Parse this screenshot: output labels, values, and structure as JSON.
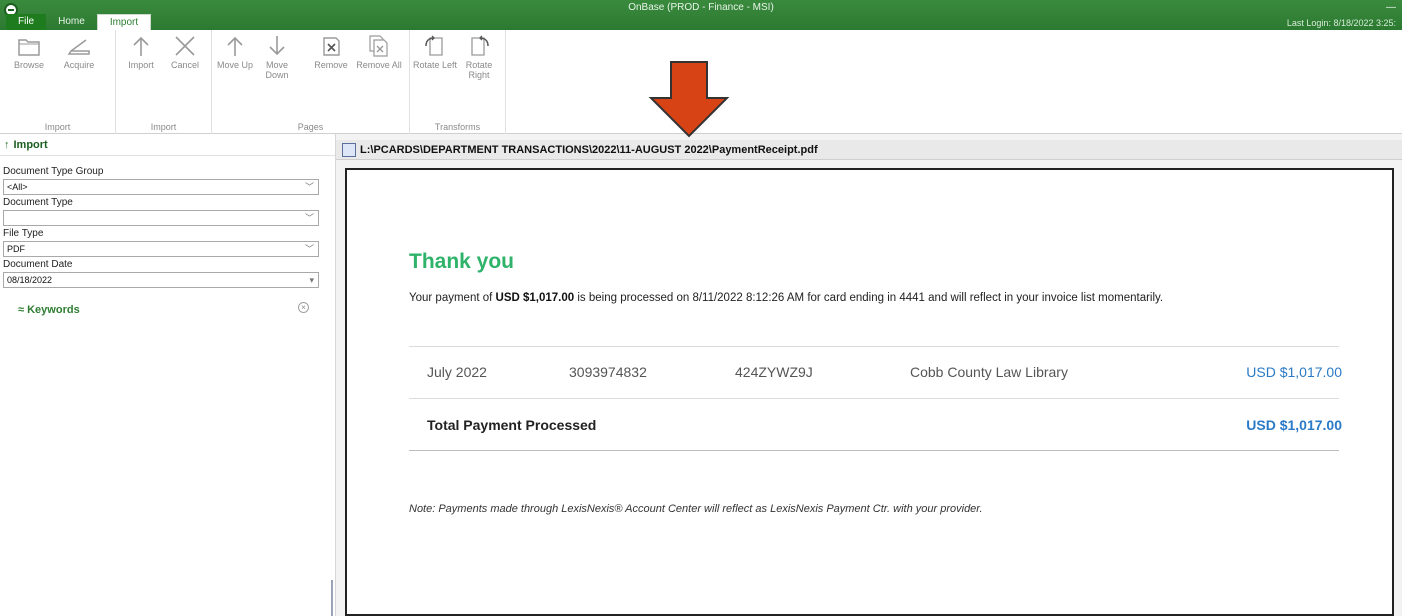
{
  "window": {
    "title": "OnBase (PROD - Finance - MSI)",
    "last_login": "Last Login: 8/18/2022 3:25:",
    "minimize": "—"
  },
  "tabs": [
    {
      "label": "File"
    },
    {
      "label": "Home"
    },
    {
      "label": "Import"
    }
  ],
  "ribbon": {
    "groups": [
      {
        "label": "Import"
      },
      {
        "label": "Import"
      },
      {
        "label": "Pages"
      },
      {
        "label": "Transforms"
      }
    ],
    "buttons": {
      "browse": "Browse",
      "acquire": "Acquire",
      "import": "Import",
      "cancel": "Cancel",
      "move_up": "Move Up",
      "move_down": "Move Down",
      "remove": "Remove",
      "remove_all": "Remove All",
      "rotate_left": "Rotate Left",
      "rotate_right": "Rotate Right"
    }
  },
  "left_panel": {
    "header": "Import",
    "fields": {
      "doc_type_group_label": "Document Type Group",
      "doc_type_group_value": "<All>",
      "doc_type_label": "Document Type",
      "doc_type_value": "",
      "file_type_label": "File Type",
      "file_type_value": "PDF",
      "doc_date_label": "Document Date",
      "doc_date_value": "08/18/2022"
    },
    "keywords_label": "Keywords"
  },
  "path": "L:\\PCARDS\\DEPARTMENT TRANSACTIONS\\2022\\11-AUGUST 2022\\PaymentReceipt.pdf",
  "document": {
    "title": "Thank you",
    "msg_prefix": "Your payment of ",
    "msg_amount": "USD $1,017.00",
    "msg_suffix": " is being processed on 8/11/2022 8:12:26 AM for card ending in 4441 and will reflect in your invoice list momentarily.",
    "row": {
      "period": "July 2022",
      "number": "3093974832",
      "code": "424ZYWZ9J",
      "vendor": "Cobb County Law Library",
      "amount": "USD $1,017.00"
    },
    "total_label": "Total Payment Processed",
    "total_amount": "USD $1,017.00",
    "note": "Note: Payments made through LexisNexis® Account Center will reflect as LexisNexis Payment Ctr. with your provider."
  },
  "colors": {
    "brand_green": "#2e7d32",
    "thank_you_green": "#2fb36a",
    "amount_blue": "#2a7ac7",
    "arrow_orange": "#d84315"
  }
}
